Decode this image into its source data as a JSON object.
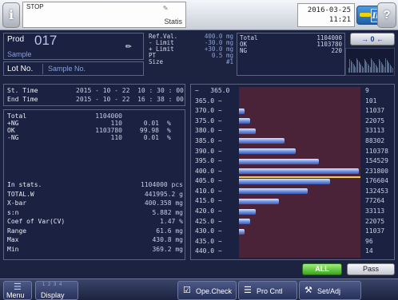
{
  "topbar": {
    "status": "STOP",
    "mode": "Statis",
    "date": "2016-03-25",
    "time": "11:21",
    "info_glyph": "i",
    "help_glyph": "?",
    "badge_glyph": "Ib"
  },
  "product": {
    "label": "Prod",
    "number": "017",
    "name": "Sample",
    "lot_label": "Lot No.",
    "lot_value": "Sample No."
  },
  "reference": [
    {
      "k": "Ref.Val.",
      "v": "400.0 mg"
    },
    {
      "k": "- Limit",
      "v": "-30.0 mg"
    },
    {
      "k": "+ Limit",
      "v": "+30.0 mg"
    },
    {
      "k": "PT",
      "v": "0.5 mg"
    },
    {
      "k": "Size",
      "v": "#1"
    }
  ],
  "counts_box": [
    {
      "k": "Total",
      "v": "1104000"
    },
    {
      "k": "OK",
      "v": "1103780"
    },
    {
      "k": "NG",
      "v": "220"
    }
  ],
  "zero_button": "→ 0 ←",
  "times": {
    "start_label": "St. Time",
    "start_value": "2015 - 10 - 22  10 : 30 : 00",
    "end_label": "End Time",
    "end_value": "2015 - 10 - 22  16 : 38 : 00"
  },
  "counts": [
    {
      "k": "Total",
      "c": "1104000",
      "p": "",
      "u": ""
    },
    {
      "k": "+NG",
      "c": "110",
      "p": "0.01",
      "u": "%"
    },
    {
      "k": "OK",
      "c": "1103780",
      "p": "99.98",
      "u": "%"
    },
    {
      "k": "-NG",
      "c": "110",
      "p": "0.01",
      "u": "%"
    }
  ],
  "stats": [
    {
      "k": "In stats.",
      "v": "1104000 pcs"
    },
    {
      "k": "TOTAL.W",
      "v": "441995.2 g"
    },
    {
      "k": "X-bar",
      "v": "400.358 mg"
    },
    {
      "k": "s:n",
      "v": "5.882 mg"
    },
    {
      "k": "Coef of Var(CV)",
      "v": "1.47 %"
    },
    {
      "k": "Range",
      "v": "61.6 mg"
    },
    {
      "k": "Max",
      "v": "430.8 mg"
    },
    {
      "k": "Min",
      "v": "369.2 mg"
    }
  ],
  "chart_data": {
    "type": "bar",
    "orientation": "horizontal",
    "categories": [
      "~   365.0",
      "365.0 ~",
      "370.0 ~",
      "375.0 ~",
      "380.0 ~",
      "385.0 ~",
      "390.0 ~",
      "395.0 ~",
      "400.0 ~",
      "405.0 ~",
      "410.0 ~",
      "415.0 ~",
      "420.0 ~",
      "425.0 ~",
      "430.0 ~",
      "435.0 ~",
      "440.0 ~"
    ],
    "values": [
      9,
      101,
      11037,
      22075,
      33113,
      88302,
      110378,
      154529,
      231800,
      176604,
      132453,
      77264,
      33113,
      22075,
      11037,
      96,
      14
    ],
    "reference_line": 400.0,
    "bar_color": "#6d8fe0",
    "background_color": "#4a2338",
    "line_color": "#f0d24a"
  },
  "filters": {
    "all": "ALL",
    "pass": "Pass"
  },
  "bottom": {
    "menu": "Menu",
    "display": "Display",
    "pages": "1 2 3 4",
    "ope": "Ope.Check",
    "pro": "Pro Cntl",
    "set": "Set/Adj"
  }
}
